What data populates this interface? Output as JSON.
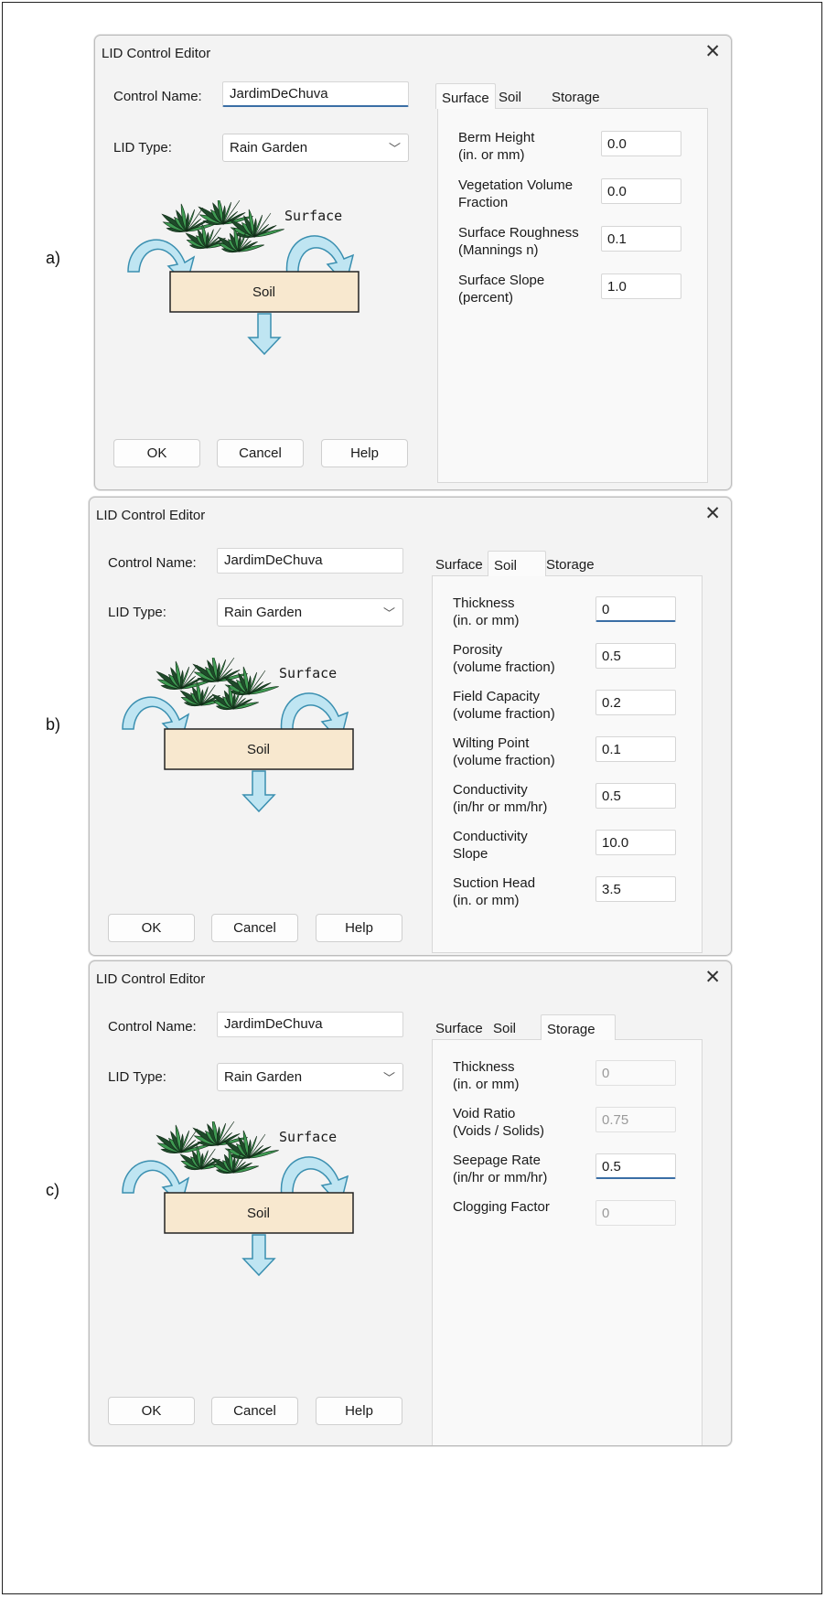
{
  "panels": [
    {
      "label": "a)",
      "window_title": "LID Control Editor",
      "close_glyph": "✕",
      "control_name_label": "Control Name:",
      "control_name_value": "JardimDeChuva",
      "lid_type_label": "LID Type:",
      "lid_type_value": "Rain Garden",
      "illustration": {
        "surface_label": "Surface",
        "soil_label": "Soil"
      },
      "buttons": {
        "ok": "OK",
        "cancel": "Cancel",
        "help": "Help"
      },
      "tabs": [
        "Surface",
        "Soil",
        "Storage"
      ],
      "active_tab": "Surface",
      "params": [
        {
          "label": [
            "Berm Height",
            "(in. or mm)"
          ],
          "value": "0.0",
          "state": "normal"
        },
        {
          "label": [
            "Vegetation Volume",
            "Fraction"
          ],
          "value": "0.0",
          "state": "normal"
        },
        {
          "label": [
            "Surface Roughness",
            "(Mannings n)"
          ],
          "value": "0.1",
          "state": "normal"
        },
        {
          "label": [
            "Surface Slope",
            "(percent)"
          ],
          "value": "1.0",
          "state": "normal"
        }
      ]
    },
    {
      "label": "b)",
      "window_title": "LID Control Editor",
      "close_glyph": "✕",
      "control_name_label": "Control Name:",
      "control_name_value": "JardimDeChuva",
      "lid_type_label": "LID Type:",
      "lid_type_value": "Rain Garden",
      "illustration": {
        "surface_label": "Surface",
        "soil_label": "Soil"
      },
      "buttons": {
        "ok": "OK",
        "cancel": "Cancel",
        "help": "Help"
      },
      "tabs": [
        "Surface",
        "Soil",
        "Storage"
      ],
      "active_tab": "Soil",
      "params": [
        {
          "label": [
            "Thickness",
            "(in. or mm)"
          ],
          "value": "0",
          "state": "focused"
        },
        {
          "label": [
            "Porosity",
            "(volume fraction)"
          ],
          "value": "0.5",
          "state": "normal"
        },
        {
          "label": [
            "Field Capacity",
            "(volume fraction)"
          ],
          "value": "0.2",
          "state": "normal"
        },
        {
          "label": [
            "Wilting Point",
            "(volume fraction)"
          ],
          "value": "0.1",
          "state": "normal"
        },
        {
          "label": [
            "Conductivity",
            "(in/hr or mm/hr)"
          ],
          "value": "0.5",
          "state": "normal"
        },
        {
          "label": [
            "Conductivity",
            "Slope"
          ],
          "value": "10.0",
          "state": "normal"
        },
        {
          "label": [
            "Suction Head",
            "(in. or mm)"
          ],
          "value": "3.5",
          "state": "normal"
        }
      ]
    },
    {
      "label": "c)",
      "window_title": "LID Control Editor",
      "close_glyph": "✕",
      "control_name_label": "Control Name:",
      "control_name_value": "JardimDeChuva",
      "lid_type_label": "LID Type:",
      "lid_type_value": "Rain Garden",
      "illustration": {
        "surface_label": "Surface",
        "soil_label": "Soil"
      },
      "buttons": {
        "ok": "OK",
        "cancel": "Cancel",
        "help": "Help"
      },
      "tabs": [
        "Surface",
        "Soil",
        "Storage"
      ],
      "active_tab": "Storage",
      "params": [
        {
          "label": [
            "Thickness",
            "(in. or mm)"
          ],
          "value": "0",
          "state": "disabled"
        },
        {
          "label": [
            "Void Ratio",
            "(Voids / Solids)"
          ],
          "value": "0.75",
          "state": "disabled"
        },
        {
          "label": [
            "Seepage Rate",
            "(in/hr or mm/hr)"
          ],
          "value": "0.5",
          "state": "focused"
        },
        {
          "label": [
            "Clogging Factor"
          ],
          "value": "0",
          "state": "disabled"
        }
      ]
    }
  ],
  "icons": {
    "close": "close-icon",
    "dropdown": "chevron-down-icon",
    "inflow": "curved-arrow-icon",
    "infiltration": "down-arrow-icon",
    "vegetation": "plant-icon"
  },
  "colors": {
    "dialog_bg": "#f3f3f3",
    "soil_fill": "#f8e8cf",
    "arrow_fill": "#bfe5f2",
    "arrow_stroke": "#3a8fb0",
    "plant_dark": "#1f4a2a",
    "plant_light": "#3f9a52",
    "focus_underline": "#3a6ea5"
  }
}
